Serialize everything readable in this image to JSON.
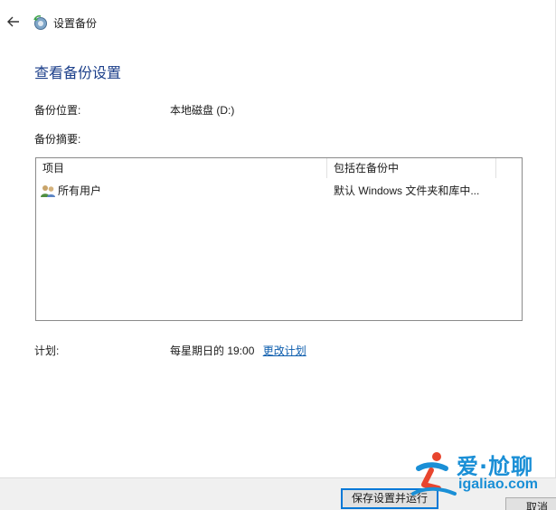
{
  "window": {
    "title": "设置备份"
  },
  "main": {
    "heading": "查看备份设置",
    "location_label": "备份位置:",
    "location_value": "本地磁盘 (D:)",
    "summary_label": "备份摘要:",
    "table": {
      "columns": [
        "项目",
        "包括在备份中"
      ],
      "rows": [
        {
          "item": "所有用户",
          "included": "默认 Windows 文件夹和库中..."
        }
      ]
    },
    "schedule_label": "计划:",
    "schedule_value": "每星期日的 19:00",
    "change_schedule_link": "更改计划"
  },
  "footer": {
    "save_run_button": "保存设置并运行",
    "cancel_button": "取消"
  },
  "watermark": {
    "line1": "爱·尬聊",
    "line2": "igaliao.com"
  },
  "colors": {
    "heading": "#1c3f8a",
    "link": "#0b5cad",
    "focus_border": "#0078d7",
    "watermark": "#1a8fd6"
  }
}
